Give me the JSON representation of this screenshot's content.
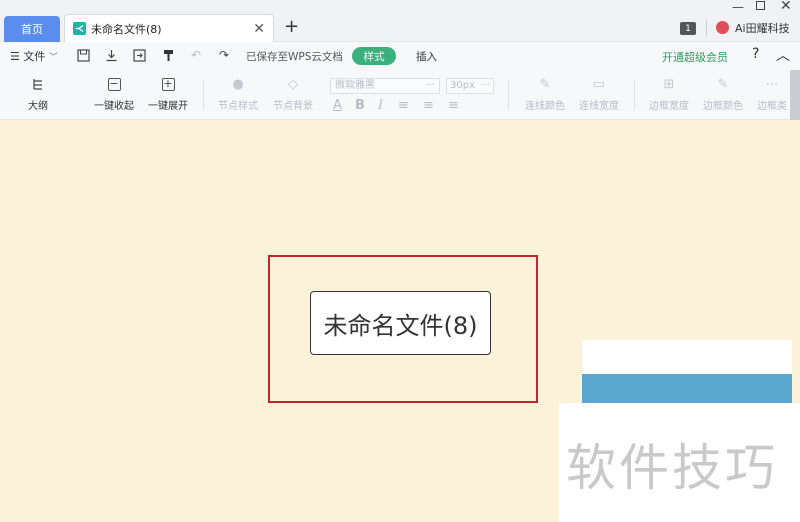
{
  "tabs": {
    "home": "首页",
    "doc": "未命名文件(8)"
  },
  "window": {
    "badge": "1",
    "user": "Ai田耀科技"
  },
  "menu": {
    "file": "文件",
    "saved": "已保存至WPS云文档",
    "style_tab": "样式",
    "insert_tab": "插入",
    "vip": "开通超级会员",
    "help": "?"
  },
  "ribbon": {
    "outline": "大纲",
    "collapse_all": "一键收起",
    "expand_all": "一键展开",
    "node_style": "节点样式",
    "node_bg": "节点背景",
    "font": "微软雅黑",
    "font_size": "30px",
    "line_color": "连线颜色",
    "line_width": "连线宽度",
    "border_width": "边框宽度",
    "border_color": "边框颜色",
    "border_type": "边框类"
  },
  "canvas": {
    "node_text": "未命名文件(8)",
    "watermark": "软件技巧"
  },
  "colors": {
    "accent": "#3bb07c",
    "home_tab": "#5b8def",
    "canvas": "#fcf1d9",
    "highlight": "#c0272d"
  }
}
